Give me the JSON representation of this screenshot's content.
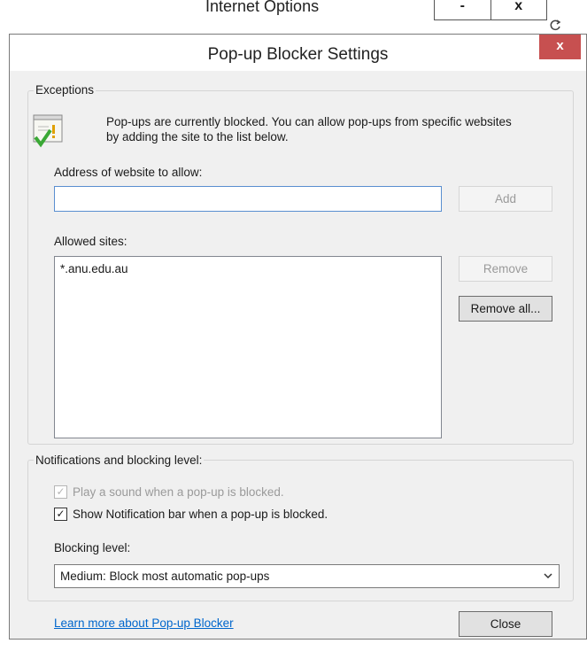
{
  "parent_window": {
    "title": "Internet Options",
    "btn_a": "-",
    "btn_b": "x",
    "refresh_icon": "refresh-icon"
  },
  "dialog": {
    "title": "Pop-up Blocker Settings",
    "close_label": "x"
  },
  "exceptions": {
    "legend": "Exceptions",
    "info": "Pop-ups are currently blocked.  You can allow pop-ups from specific websites by adding the site to the list below.",
    "address_label": "Address of website to allow:",
    "address_value": "",
    "add_label": "Add",
    "allowed_label": "Allowed sites:",
    "allowed_sites": [
      "*.anu.edu.au"
    ],
    "remove_label": "Remove",
    "remove_all_label": "Remove all..."
  },
  "notifications": {
    "legend": "Notifications and blocking level:",
    "play_sound_label": "Play a sound when a pop-up is blocked.",
    "play_sound_checked": true,
    "play_sound_enabled": false,
    "show_bar_label": "Show Notification bar when a pop-up is blocked.",
    "show_bar_checked": true,
    "blocking_label": "Blocking level:",
    "blocking_value": "Medium: Block most automatic pop-ups"
  },
  "footer": {
    "learn_more": "Learn more about Pop-up Blocker",
    "close_label": "Close"
  },
  "colors": {
    "close_button": "#c75050",
    "link": "#0066cc",
    "dialog_bg": "#f0f0f0"
  }
}
